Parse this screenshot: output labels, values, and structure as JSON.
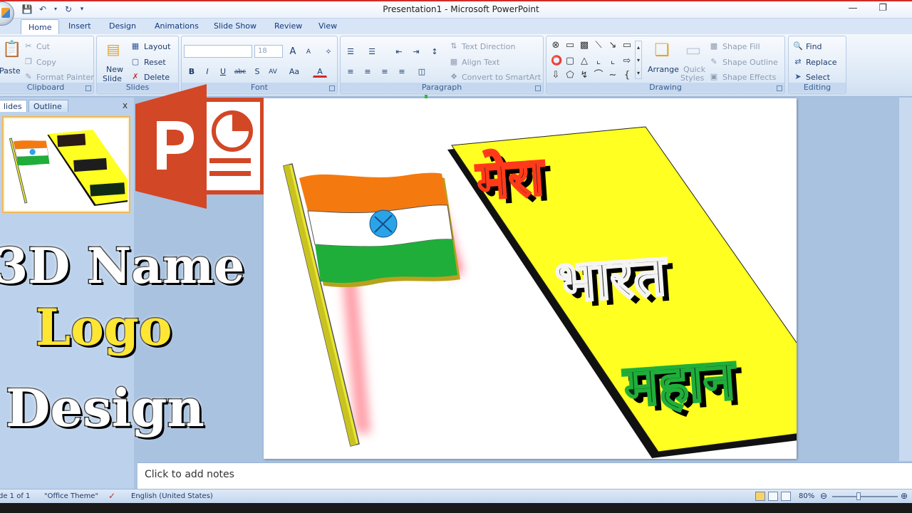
{
  "window": {
    "title": "Presentation1 - Microsoft PowerPoint"
  },
  "tabs": [
    "Home",
    "Insert",
    "Design",
    "Animations",
    "Slide Show",
    "Review",
    "View"
  ],
  "ribbon": {
    "clipboard": {
      "label": "Clipboard",
      "paste": "Paste",
      "cut": "Cut",
      "copy": "Copy",
      "format_painter": "Format Painter"
    },
    "slides": {
      "label": "Slides",
      "new_slide_1": "New",
      "new_slide_2": "Slide",
      "layout": "Layout",
      "reset": "Reset",
      "delete": "Delete"
    },
    "font": {
      "label": "Font",
      "font_size": "18",
      "bold": "B",
      "italic": "I",
      "underline": "U",
      "strike": "abc",
      "shadow": "S",
      "spacing": "AV",
      "case": "Aa",
      "color": "A",
      "grow": "A",
      "shrink": "A"
    },
    "paragraph": {
      "label": "Paragraph",
      "text_direction": "Text Direction",
      "align_text": "Align Text",
      "convert_smartart": "Convert to SmartArt"
    },
    "drawing": {
      "label": "Drawing",
      "arrange": "Arrange",
      "quick_styles_1": "Quick",
      "quick_styles_2": "Styles",
      "shape_fill": "Shape Fill",
      "shape_outline": "Shape Outline",
      "shape_effects": "Shape Effects"
    },
    "editing": {
      "label": "Editing",
      "find": "Find",
      "replace": "Replace",
      "select": "Select"
    }
  },
  "left_pane": {
    "tab_slides": "lides",
    "tab_outline": "Outline",
    "close": "x"
  },
  "overlay_text": {
    "line1": "3D Name",
    "line2": "Logo",
    "line3": "Design"
  },
  "slide": {
    "word1": "मेरा",
    "word2": "भारत",
    "word3": "महान",
    "colors": {
      "board": "#ffff22",
      "saffron": "#f47a10",
      "green": "#1fae3a",
      "chakra": "#2aa4e6"
    }
  },
  "notes": {
    "placeholder": "Click to add notes"
  },
  "status": {
    "slide": "de 1 of 1",
    "theme": "\"Office Theme\"",
    "language": "English (United States)",
    "zoom": "80%",
    "zoom_level": 0.8
  },
  "icons": [
    "save-icon",
    "undo-icon",
    "redo-icon",
    "paste-icon",
    "cut-icon",
    "copy-icon",
    "format-painter-icon",
    "new-slide-icon",
    "find-icon",
    "powerpoint-logo-icon"
  ]
}
